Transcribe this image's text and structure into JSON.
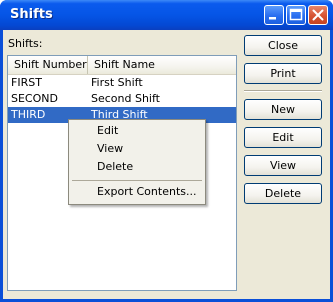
{
  "window": {
    "title": "Shifts"
  },
  "list": {
    "label": "Shifts:",
    "columns": [
      "Shift Number",
      "Shift Name"
    ],
    "rows": [
      {
        "number": "FIRST",
        "name": "First Shift"
      },
      {
        "number": "SECOND",
        "name": "Second Shift"
      },
      {
        "number": "THIRD",
        "name": "Third Shift"
      }
    ],
    "selected_row": "THIRD"
  },
  "buttons": {
    "close": "Close",
    "print": "Print",
    "new": "New",
    "edit": "Edit",
    "view": "View",
    "delete": "Delete"
  },
  "context_menu": {
    "items": [
      "Edit",
      "View",
      "Delete",
      "Export Contents..."
    ]
  },
  "colors": {
    "title_bar": "#0555e6",
    "selection": "#316ac5",
    "client": "#ece9d8"
  }
}
